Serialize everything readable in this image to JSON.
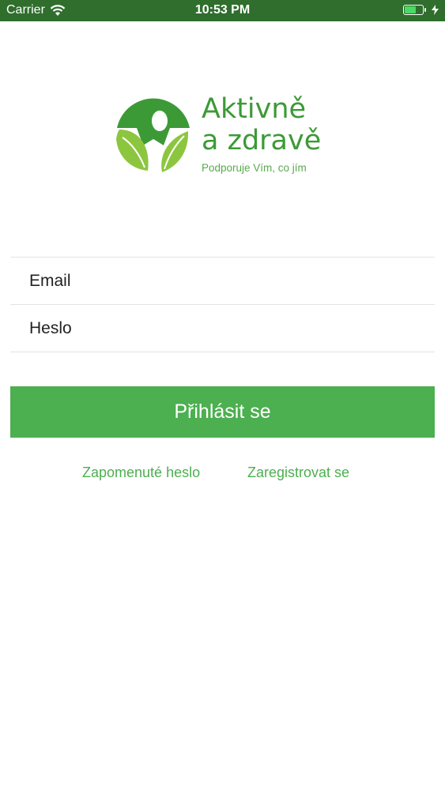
{
  "status_bar": {
    "carrier": "Carrier",
    "time": "10:53 PM",
    "battery_level": 0.6,
    "icons": [
      "wifi-icon",
      "battery-icon",
      "charging-bolt-icon"
    ]
  },
  "logo": {
    "title_line1": "Aktivně",
    "title_line2": "a zdravě",
    "subtitle": "Podporuje Vím, co jím",
    "colors": {
      "dark_green": "#3c9a36",
      "light_green": "#8cc63f"
    }
  },
  "form": {
    "email_placeholder": "Email",
    "password_placeholder": "Heslo",
    "email_value": "",
    "password_value": ""
  },
  "login_button_label": "Přihlásit se",
  "links": {
    "forgot_password": "Zapomenuté heslo",
    "register": "Zaregistrovat se"
  },
  "colors": {
    "status_bar": "#2f6e2c",
    "accent": "#4caf50"
  }
}
